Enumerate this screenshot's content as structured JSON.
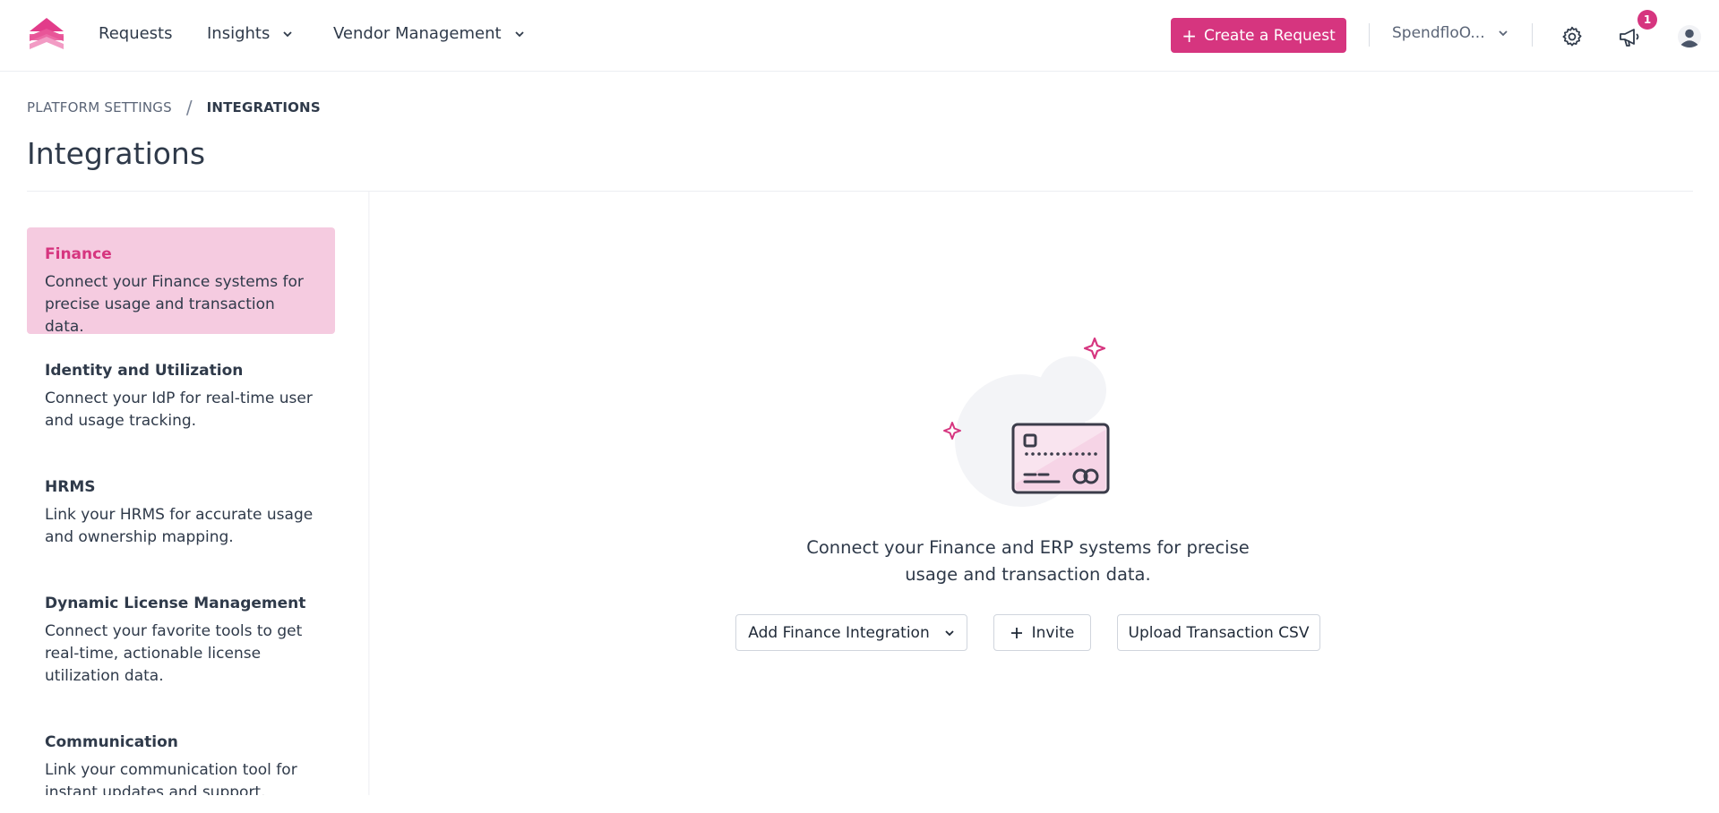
{
  "nav": {
    "items": [
      {
        "label": "Requests"
      },
      {
        "label": "Insights"
      },
      {
        "label": "Vendor Management"
      }
    ],
    "create_label": "Create a Request",
    "org_label": "SpendfloO...",
    "notifications_count": "1"
  },
  "breadcrumb": {
    "parent": "PLATFORM SETTINGS",
    "separator": "/",
    "current": "INTEGRATIONS"
  },
  "page_title": "Integrations",
  "sidebar": {
    "items": [
      {
        "title": "Finance",
        "desc": "Connect your Finance systems for precise usage and transaction data."
      },
      {
        "title": "Identity and Utilization",
        "desc": "Connect your IdP for real-time user and usage tracking."
      },
      {
        "title": "HRMS",
        "desc": "Link your HRMS for accurate usage and ownership mapping."
      },
      {
        "title": "Dynamic License Management",
        "desc": "Connect your favorite tools to get real-time, actionable license utilization data."
      },
      {
        "title": "Communication",
        "desc": "Link your communication tool for instant updates and support."
      }
    ]
  },
  "empty_state": {
    "message": "Connect your Finance and ERP systems for precise usage and transaction data.",
    "add_integration_label": "Add Finance Integration",
    "invite_label": "Invite",
    "upload_label": "Upload Transaction CSV"
  },
  "colors": {
    "accent": "#d6357f",
    "active_bg": "#f5cbe0",
    "text": "#2f3a4a"
  },
  "icons": [
    "logo-icon",
    "chevron-down-icon",
    "plus-icon",
    "gear-icon",
    "megaphone-icon",
    "user-avatar-icon",
    "credit-card-icon",
    "sparkle-icon"
  ]
}
